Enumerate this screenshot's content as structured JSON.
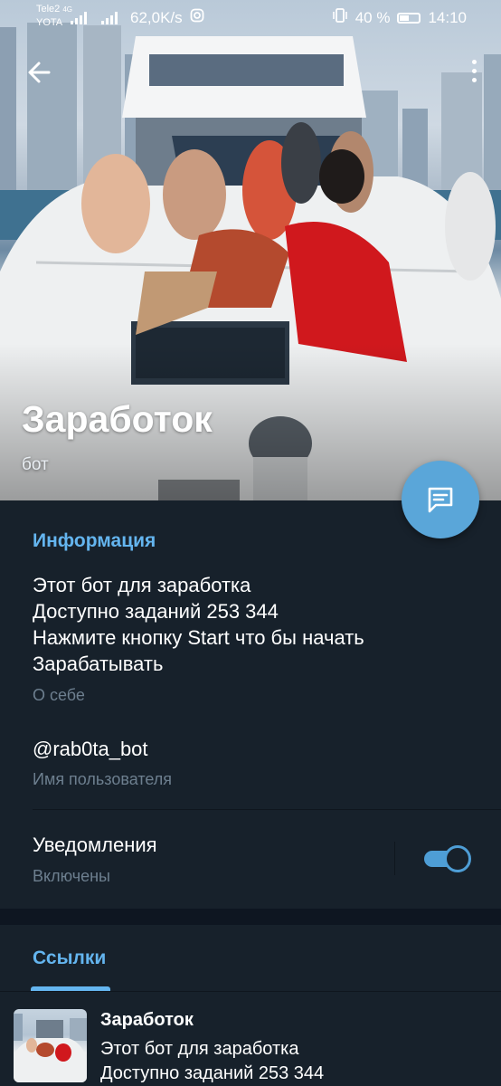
{
  "status_bar": {
    "carrier_1": "Tele2",
    "carrier_1_net": "4G",
    "carrier_2": "YOTA",
    "speed": "62,0K/s",
    "battery": "40 %",
    "time": "14:10"
  },
  "header": {
    "name": "Заработок",
    "subtitle": "бот"
  },
  "info": {
    "section_title": "Информация",
    "about_lines": [
      "Этот бот для заработка",
      "Доступно заданий 253 344",
      "Нажмите кнопку Start что бы начать",
      "Зарабатывать"
    ],
    "about_caption": "О себе",
    "username": "@rab0ta_bot",
    "username_caption": "Имя пользователя",
    "notifications_label": "Уведомления",
    "notifications_state": "Включены",
    "notifications_on": true
  },
  "links": {
    "tab_label": "Ссылки",
    "items": [
      {
        "title": "Заработок",
        "lines": [
          "Этот бот для заработка",
          "Доступно заданий 253 344"
        ]
      }
    ]
  },
  "colors": {
    "accent": "#64b5ef",
    "background": "#17212b",
    "fab": "#5aa6d9",
    "caption": "#6d7f8f"
  },
  "icons": [
    "back-arrow-icon",
    "more-vert-icon",
    "message-icon",
    "signal-icon",
    "instagram-icon",
    "vibrate-icon",
    "battery-icon"
  ]
}
